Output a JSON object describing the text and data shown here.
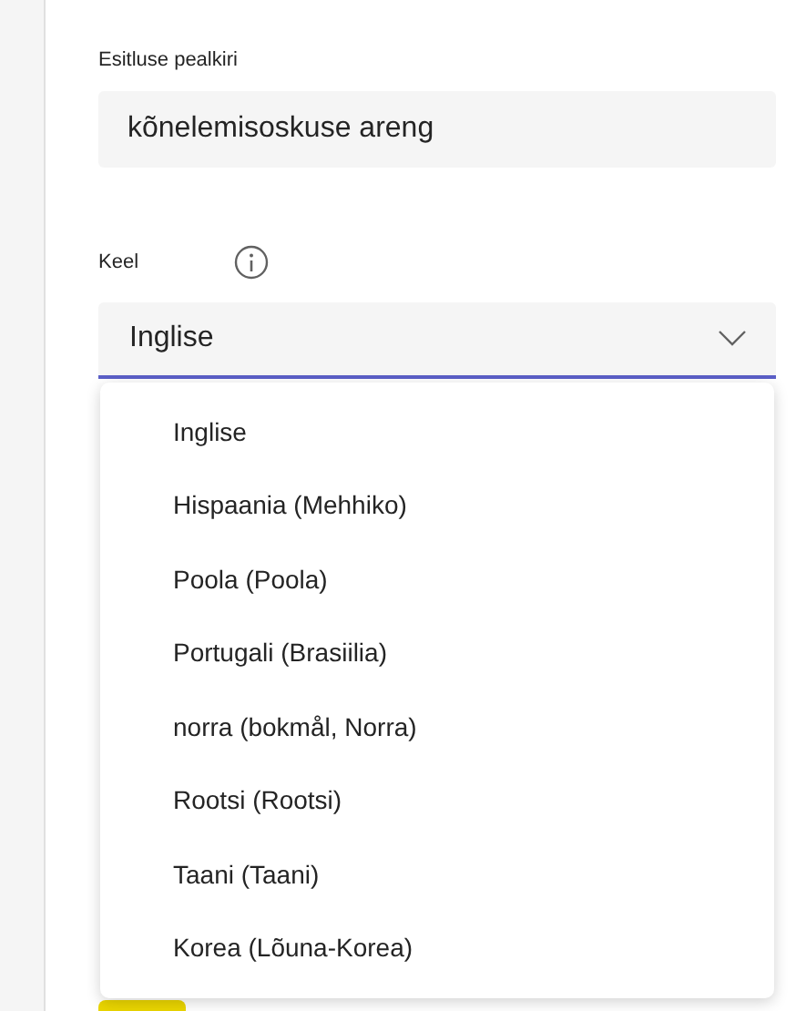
{
  "title_field": {
    "label": "Esitluse pealkiri",
    "value": "kõnelemisoskuse areng"
  },
  "language_field": {
    "label": "Keel",
    "value": "Inglise",
    "expanded": true
  },
  "language_options": [
    {
      "label": "Inglise"
    },
    {
      "label": "Hispaania (Mehhiko)"
    },
    {
      "label": "Poola (Poola)"
    },
    {
      "label": "Portugali (Brasiilia)"
    },
    {
      "label": "norra (bokmål, Norra)"
    },
    {
      "label": "Rootsi (Rootsi)"
    },
    {
      "label": "Taani (Taani)"
    },
    {
      "label": "Korea (Lõuna-Korea)"
    }
  ]
}
